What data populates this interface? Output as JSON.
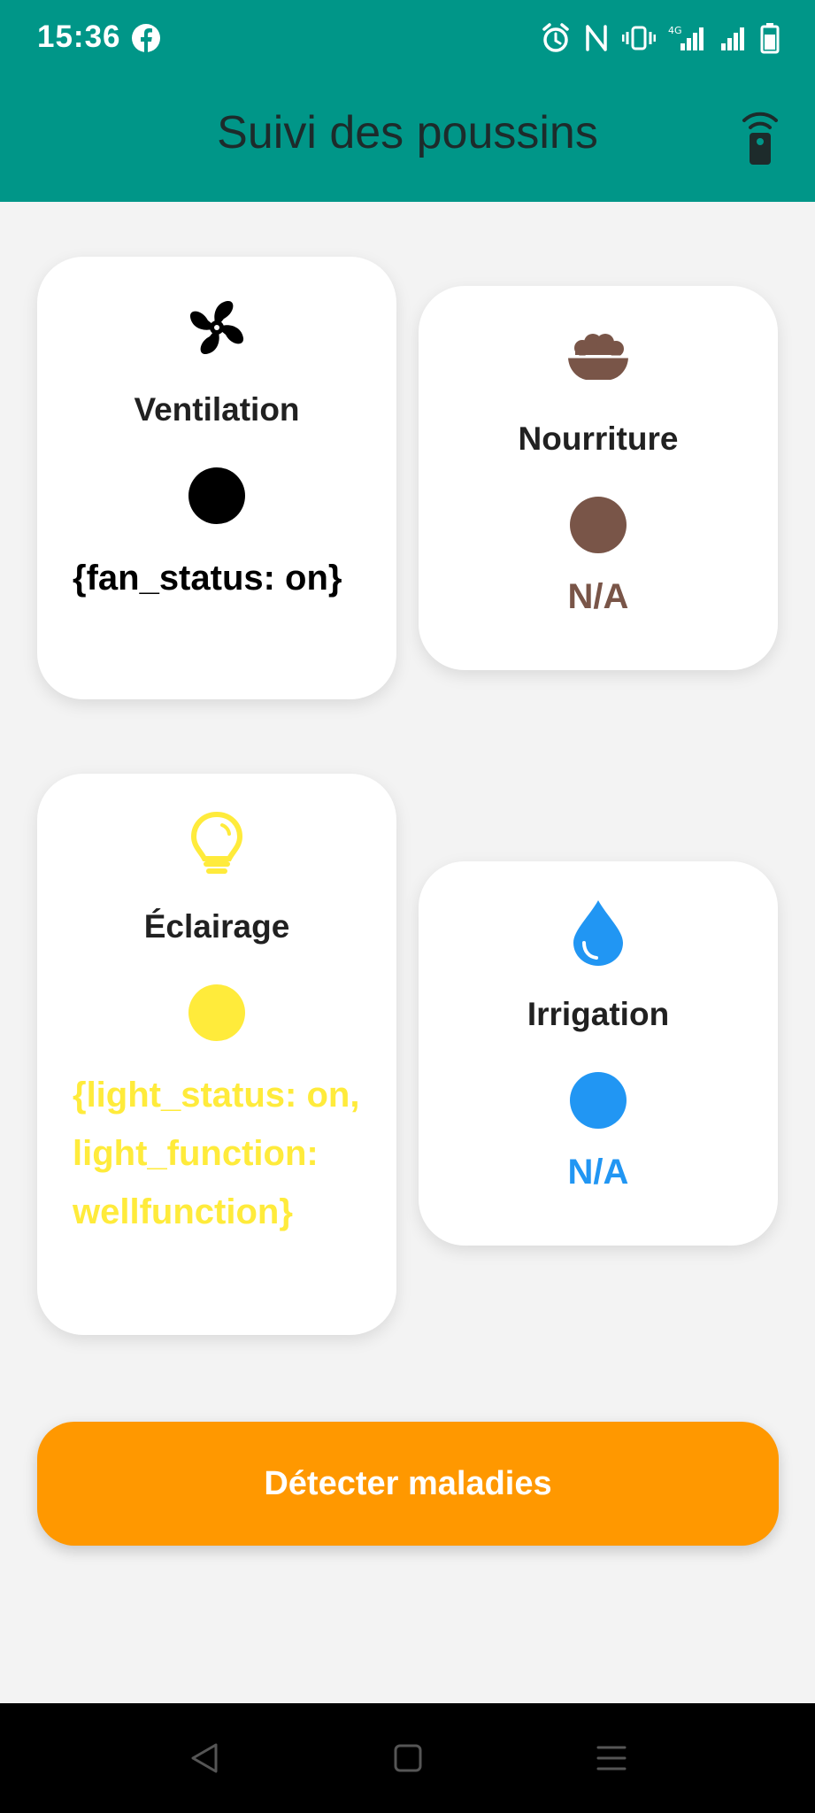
{
  "status_bar": {
    "time": "15:36",
    "icons": [
      "facebook-icon",
      "alarm-icon",
      "nfc-icon",
      "vibrate-icon",
      "signal-4g-icon",
      "signal-icon",
      "battery-icon"
    ],
    "network_label": "4G"
  },
  "header": {
    "title": "Suivi des poussins",
    "action_icon": "remote-icon",
    "background": "#009688"
  },
  "cards": {
    "ventilation": {
      "label": "Ventilation",
      "icon": "fan-icon",
      "color": "#000000",
      "value": "{fan_status: on}"
    },
    "nourriture": {
      "label": "Nourriture",
      "icon": "food-bowl-icon",
      "color": "#795548",
      "value": "N/A"
    },
    "eclairage": {
      "label": "Éclairage",
      "icon": "lightbulb-icon",
      "color": "#ffeb3b",
      "value": "{light_status: on, light_function: wellfunction}"
    },
    "irrigation": {
      "label": "Irrigation",
      "icon": "water-drop-icon",
      "color": "#2196f3",
      "value": "N/A"
    }
  },
  "actions": {
    "detect_label": "Détecter maladies",
    "detect_color": "#ff9800"
  },
  "nav_bar": {
    "icons": [
      "back-icon",
      "home-icon",
      "menu-icon"
    ]
  }
}
